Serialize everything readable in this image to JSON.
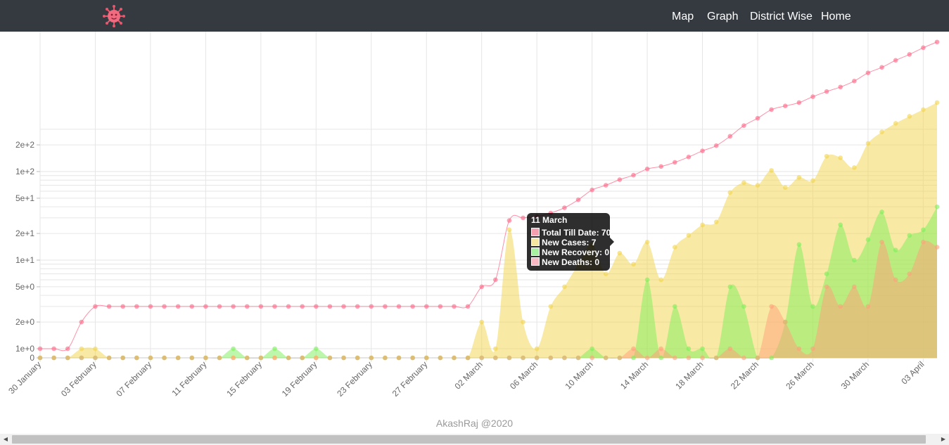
{
  "nav": {
    "logo_icon": "virus-icon",
    "items": [
      {
        "label": "Map"
      },
      {
        "label": "Graph"
      },
      {
        "label": "District Wise"
      },
      {
        "label": "Home"
      }
    ]
  },
  "chart_data": {
    "type": "area",
    "y_scale": "log",
    "y_tick_labels": [
      "0",
      "1e+0",
      "2e+0",
      "5e+0",
      "1e+1",
      "2e+1",
      "5e+1",
      "1e+2",
      "2e+2"
    ],
    "x_tick_labels": [
      "30 January",
      "03 February",
      "07 February",
      "11 February",
      "15 February",
      "19 February",
      "23 February",
      "27 February",
      "02 March",
      "06 March",
      "10 March",
      "14 March",
      "18 March",
      "22 March",
      "26 March",
      "30 March",
      "03 April"
    ],
    "x_start": "30 January",
    "x_end": "03 April",
    "grid": true,
    "colors": {
      "total": "#ff6384",
      "cases": "#f1d44a",
      "recovery": "#7cf05a",
      "deaths": "#ffa07a"
    },
    "series": [
      {
        "name": "Total Till Date",
        "values": [
          1,
          1,
          1,
          2,
          3,
          3,
          3,
          3,
          3,
          3,
          3,
          3,
          3,
          3,
          3,
          3,
          3,
          3,
          3,
          3,
          3,
          3,
          3,
          3,
          3,
          3,
          3,
          3,
          3,
          3,
          3,
          3,
          5,
          6,
          28,
          30,
          31,
          34,
          39,
          48,
          62,
          70,
          81,
          91,
          107,
          114,
          127,
          146,
          171,
          196,
          250,
          330,
          400,
          500,
          550,
          600,
          700,
          800,
          900,
          1050,
          1300,
          1500,
          1800,
          2100,
          2500,
          2900
        ]
      },
      {
        "name": "New Cases",
        "values": [
          0,
          0,
          0,
          1,
          1,
          0,
          0,
          0,
          0,
          0,
          0,
          0,
          0,
          0,
          0,
          0,
          0,
          0,
          0,
          0,
          0,
          0,
          0,
          0,
          0,
          0,
          0,
          0,
          0,
          0,
          0,
          0,
          2,
          1,
          22,
          2,
          1,
          3,
          5,
          9,
          15,
          7,
          12,
          9,
          16,
          6,
          14,
          19,
          25,
          27,
          58,
          75,
          70,
          103,
          66,
          86,
          79,
          149,
          143,
          111,
          208,
          280,
          350,
          420,
          500,
          600
        ]
      },
      {
        "name": "New Recovery",
        "values": [
          0,
          0,
          0,
          0,
          0,
          0,
          0,
          0,
          0,
          0,
          0,
          0,
          0,
          0,
          1,
          0,
          0,
          1,
          0,
          0,
          1,
          0,
          0,
          0,
          0,
          0,
          0,
          0,
          0,
          0,
          0,
          0,
          0,
          0,
          0,
          0,
          0,
          0,
          0,
          0,
          1,
          0,
          0,
          0,
          6,
          0,
          3,
          1,
          1,
          0,
          5,
          3,
          0,
          0,
          2,
          15,
          3,
          7,
          25,
          10,
          17,
          35,
          13,
          19,
          22,
          40
        ]
      },
      {
        "name": "New Deaths",
        "values": [
          0,
          0,
          0,
          0,
          0,
          0,
          0,
          0,
          0,
          0,
          0,
          0,
          0,
          0,
          0,
          0,
          0,
          0,
          0,
          0,
          0,
          0,
          0,
          0,
          0,
          0,
          0,
          0,
          0,
          0,
          0,
          0,
          0,
          0,
          0,
          0,
          0,
          0,
          0,
          0,
          0,
          0,
          0,
          1,
          0,
          1,
          0,
          0,
          0,
          0,
          1,
          0,
          0,
          3,
          2,
          1,
          1,
          5,
          3,
          5,
          3,
          16,
          6,
          7,
          16,
          14
        ]
      }
    ],
    "tooltip": {
      "title": "11 March",
      "rows": [
        {
          "label": "Total Till Date: 70"
        },
        {
          "label": "New Cases: 7"
        },
        {
          "label": "New Recovery: 0"
        },
        {
          "label": "New Deaths: 0"
        }
      ]
    }
  },
  "footer": {
    "text": "AkashRaj @2020"
  }
}
